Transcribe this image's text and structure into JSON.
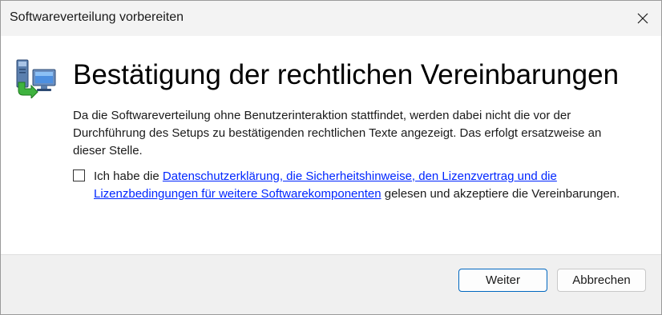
{
  "window": {
    "title": "Softwareverteilung vorbereiten",
    "close_icon": "close-icon"
  },
  "main": {
    "icon": "computer-network-install-icon",
    "heading": "Bestätigung der rechtlichen Vereinbarungen",
    "description": "Da die Softwareverteilung ohne Benutzerinteraktion stattfindet, werden dabei nicht die vor der Durchführung des Setups zu bestätigenden rechtlichen Texte angezeigt. Das erfolgt ersatzweise an dieser Stelle.",
    "consent": {
      "checked": false,
      "prefix": "Ich habe die ",
      "link": "Datenschutzerklärung, die Sicherheitshinweise, den Lizenzvertrag und die Lizenzbedingungen für weitere Softwarekomponenten",
      "suffix": " gelesen und akzeptiere die Vereinbarungen."
    }
  },
  "footer": {
    "primary_label": "Weiter",
    "secondary_label": "Abbrechen"
  },
  "colors": {
    "link": "#0026ff",
    "primary_border": "#0067c0",
    "footer_bg": "#f0f0f0",
    "titlebar_bg": "#f3f3f3"
  }
}
